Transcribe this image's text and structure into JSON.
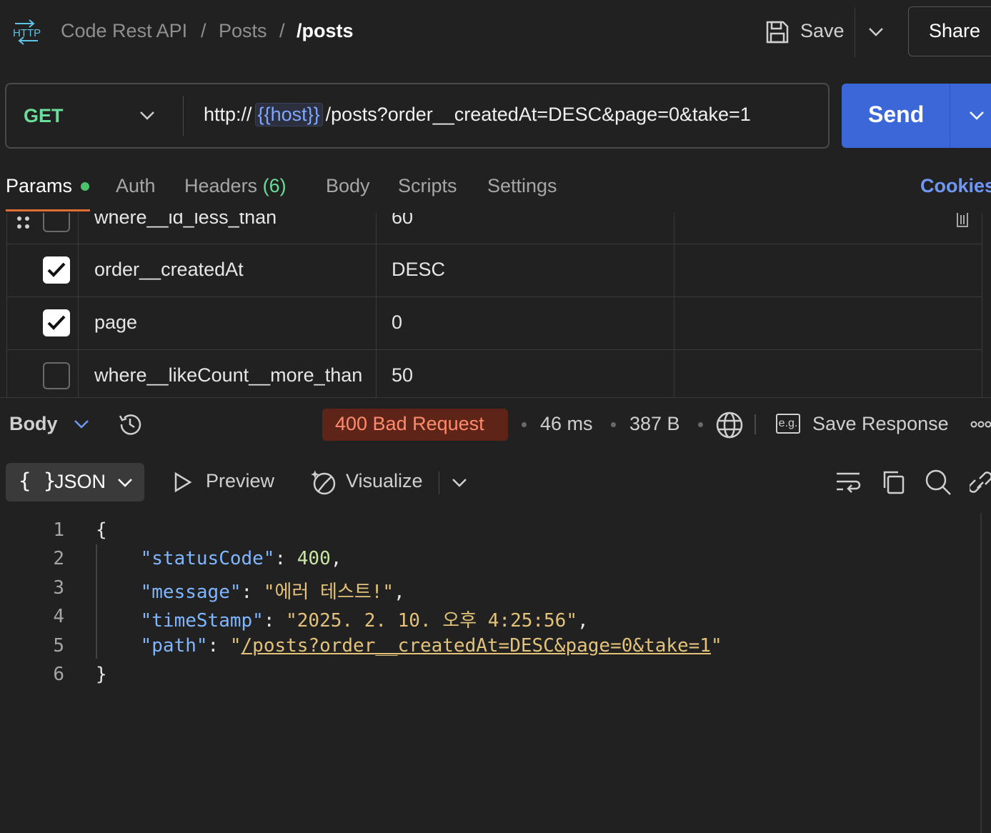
{
  "header": {
    "http_badge": "HTTP",
    "breadcrumb": [
      "Code Rest API",
      "Posts",
      "/posts"
    ],
    "save_label": "Save",
    "share_label": "Share"
  },
  "request": {
    "method": "GET",
    "url_prefix": "http://",
    "url_variable": "{{host}}",
    "url_suffix": "/posts?order__createdAt=DESC&page=0&take=1",
    "send_label": "Send"
  },
  "tabs": {
    "params": "Params",
    "auth": "Auth",
    "headers": "Headers",
    "headers_count": "(6)",
    "body": "Body",
    "scripts": "Scripts",
    "settings": "Settings",
    "cookies": "Cookies"
  },
  "params": [
    {
      "key": "where__id_less_than",
      "value": "60",
      "checked": false
    },
    {
      "key": "order__createdAt",
      "value": "DESC",
      "checked": true
    },
    {
      "key": "page",
      "value": "0",
      "checked": true
    },
    {
      "key": "where__likeCount__more_than",
      "value": "50",
      "checked": false
    }
  ],
  "response": {
    "section_label": "Body",
    "status": "400 Bad Request",
    "time": "46 ms",
    "size": "387 B",
    "save_response_label": "Save Response",
    "eg_badge": "e.g.",
    "format_label": "JSON",
    "format_braces": "{ }",
    "preview_label": "Preview",
    "visualize_label": "Visualize"
  },
  "code": {
    "line_numbers": [
      "1",
      "2",
      "3",
      "4",
      "5",
      "6"
    ],
    "open_brace": "{",
    "close_brace": "}",
    "lines": [
      {
        "key": "\"statusCode\"",
        "value": "400",
        "value_type": "number"
      },
      {
        "key": "\"message\"",
        "value": "\"에러 테스트!\"",
        "value_type": "string"
      },
      {
        "key": "\"timeStamp\"",
        "value": "\"2025. 2. 10. 오후 4:25:56\"",
        "value_type": "string"
      },
      {
        "key": "\"path\"",
        "value_open": "\"",
        "value_link": "/posts?order__createdAt=DESC&page=0&take=1",
        "value_close": "\"",
        "value_type": "link"
      }
    ]
  },
  "colors": {
    "accent_blue": "#3c67d9",
    "method_green": "#6bdd9a",
    "status_bg": "#5e2418",
    "status_text": "#ff8b6e",
    "tab_underline": "#e06c36"
  }
}
